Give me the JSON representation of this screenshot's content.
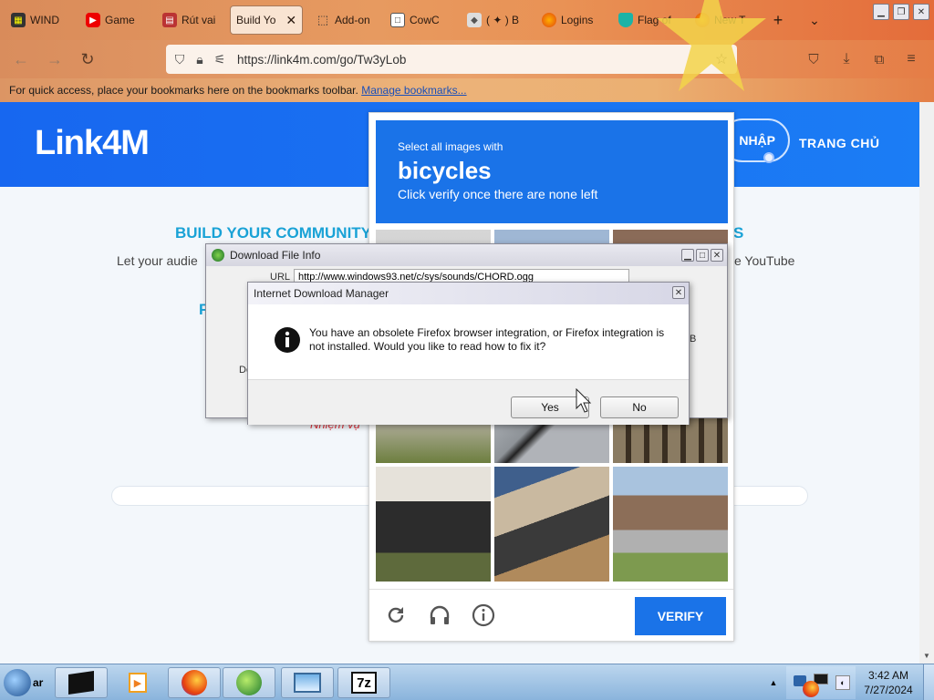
{
  "tabs": [
    {
      "label": "WIND",
      "icon": "app-icon"
    },
    {
      "label": "Game",
      "icon": "youtube-icon"
    },
    {
      "label": "Rút vai",
      "icon": "page-icon"
    },
    {
      "label": "Build Yo",
      "icon": "none",
      "active": true
    },
    {
      "label": "Add-on",
      "icon": "puzzle-icon"
    },
    {
      "label": "CowC",
      "icon": "page-icon"
    },
    {
      "label": "( ✦ ) B",
      "icon": "page-icon"
    },
    {
      "label": "Logins",
      "icon": "firefox-icon"
    },
    {
      "label": "Flag of",
      "icon": "page-icon"
    },
    {
      "label": "New T",
      "icon": "firefox-icon"
    }
  ],
  "address": {
    "url": "https://link4m.com/go/Tw3yLob"
  },
  "bookmarks": {
    "text": "For quick access, place your bookmarks here on the bookmarks toolbar.",
    "link": "Manage bookmarks..."
  },
  "site": {
    "logo": "Link4M",
    "login": "NHẬP",
    "home": "TRANG CHỦ",
    "heading_left": "BUILD YOUR COMMUNITY",
    "heading_right": "S",
    "text_left": "Let your audie",
    "text_right": "ke YouTube",
    "frag_f": "F",
    "frag_nhiem": "Nhiệm vụ"
  },
  "captcha": {
    "line1": "Select all images with",
    "keyword": "bicycles",
    "line3": "Click verify once there are none left",
    "verify": "VERIFY"
  },
  "download_info": {
    "title": "Download File Info",
    "url_label": "URL",
    "url_value": "http://www.windows93.net/c/sys/sounds/CHORD.ogg",
    "frag_de": "De",
    "frag_b": "B"
  },
  "idm_dialog": {
    "title": "Internet Download Manager",
    "message": "You have an obsolete Firefox browser integration, or Firefox integration is not installed. Would you like to read how to fix it?",
    "yes": "Yes",
    "no": "No"
  },
  "taskbar": {
    "start_label": "ar",
    "time": "3:42 AM",
    "date": "7/27/2024"
  },
  "colors": {
    "brand_blue": "#1a73e8",
    "heading_cyan": "#19a2d6",
    "tab_bar": "#e79a60"
  }
}
